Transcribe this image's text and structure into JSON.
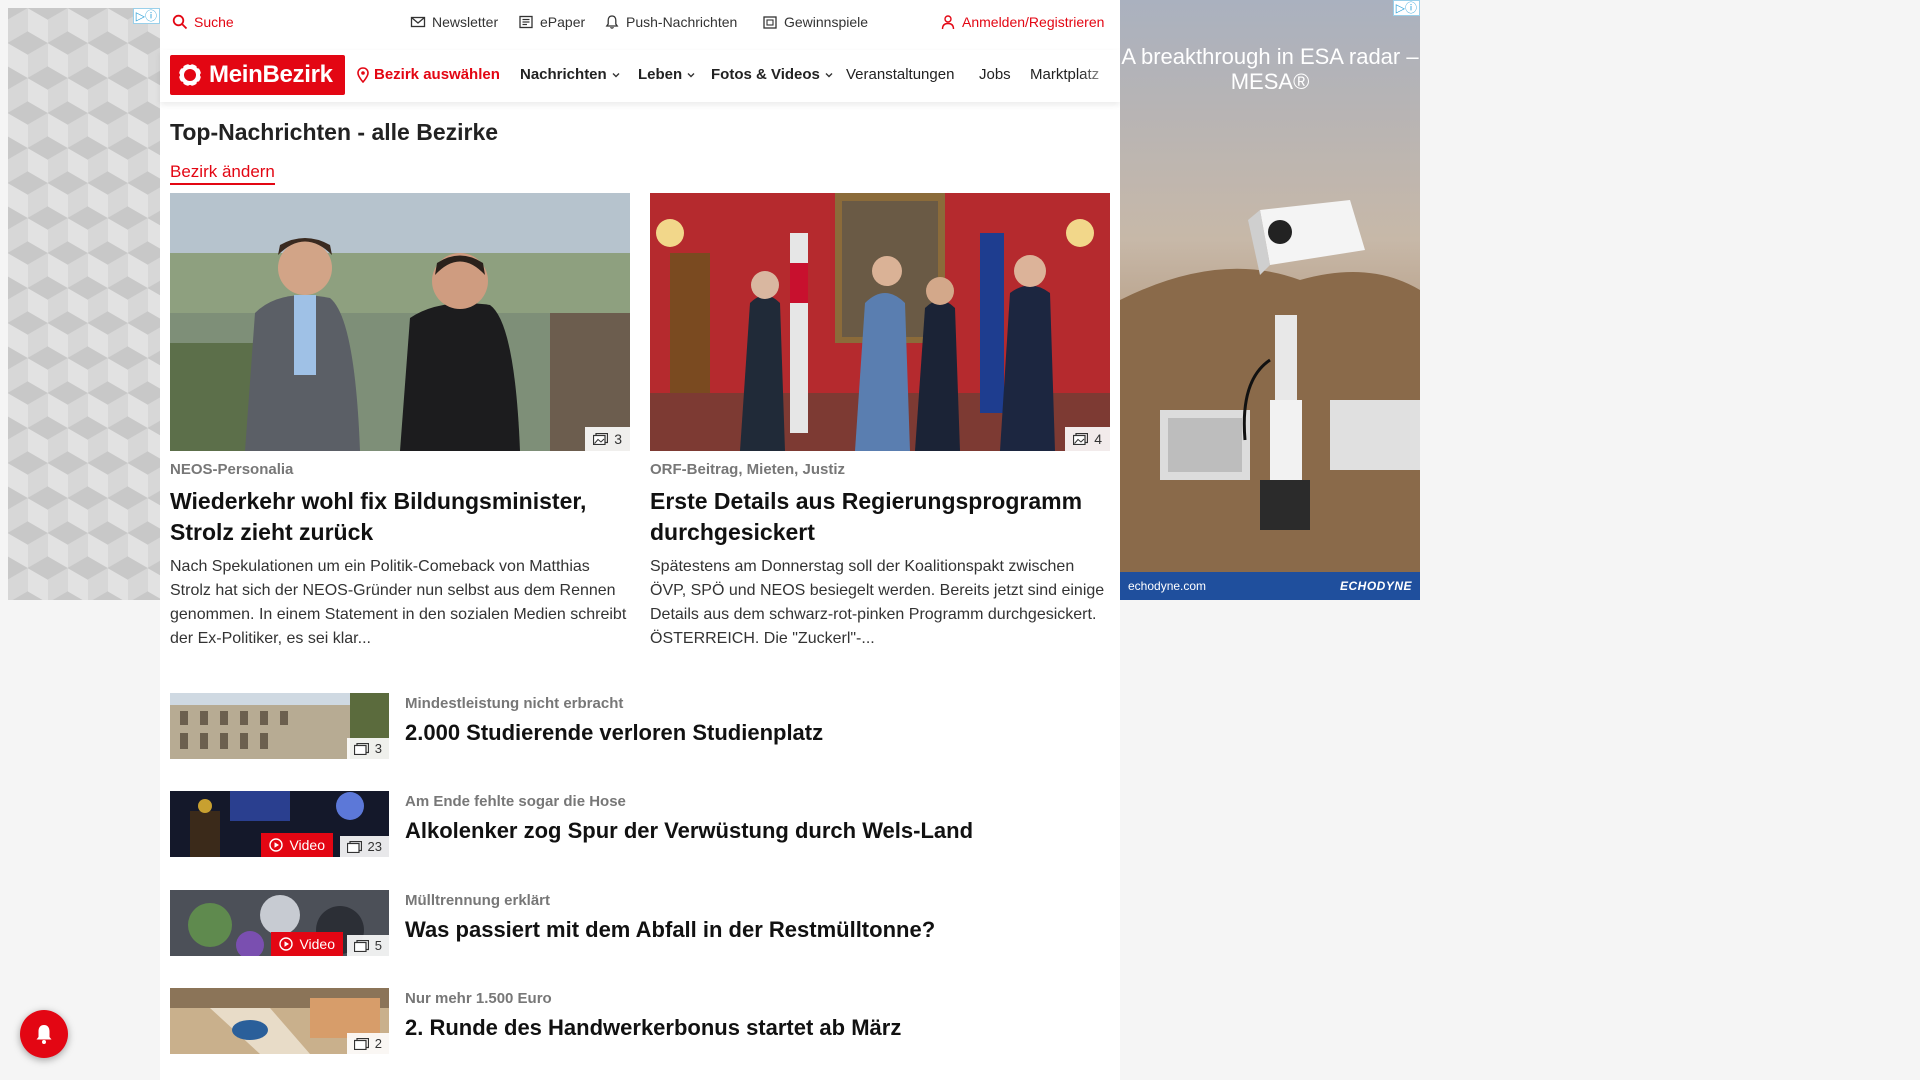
{
  "left_ad": {
    "adchoices_label": "▷ⓘ"
  },
  "topbar": {
    "search_label": "Suche",
    "newsletter_label": "Newsletter",
    "epaper_label": "ePaper",
    "push_label": "Push-Nachrichten",
    "sweepstakes_label": "Gewinnspiele",
    "login_label": "Anmelden/Registrieren"
  },
  "navbar": {
    "logo_text": "MeinBezirk",
    "select_district_label": "Bezirk auswählen",
    "items": [
      {
        "label": "Nachrichten",
        "has_dropdown": true
      },
      {
        "label": "Leben",
        "has_dropdown": true
      },
      {
        "label": "Fotos & Videos",
        "has_dropdown": true
      },
      {
        "label": "Veranstaltungen",
        "has_dropdown": false
      },
      {
        "label": "Jobs",
        "has_dropdown": false
      },
      {
        "label": "Marktplatz",
        "has_dropdown": false
      }
    ]
  },
  "section": {
    "title": "Top-Nachrichten - alle Bezirke",
    "change_district_label": "Bezirk ändern"
  },
  "featured": [
    {
      "image_count": "3",
      "kicker": "NEOS-Personalia",
      "headline": "Wiederkehr wohl fix Bildungsminister, Strolz zieht zurück",
      "teaser": "Nach Spekulationen um ein Politik-Comeback von Matthias Strolz hat sich der NEOS-Gründer nun selbst aus dem Rennen genommen. In einem Statement in den sozialen Medien schreibt der Ex-Politiker, es sei klar..."
    },
    {
      "image_count": "4",
      "kicker": "ORF-Beitrag, Mieten, Justiz",
      "headline": "Erste Details aus Regierungsprogramm durchgesickert",
      "teaser": "Spätestens am Donnerstag soll der Koalitionspakt zwischen ÖVP, SPÖ und NEOS besiegelt werden. Bereits jetzt sind einige Details aus dem schwarz-rot-pinken Programm durchgesickert.  ÖSTERREICH. Die \"Zuckerl\"-..."
    }
  ],
  "articles": [
    {
      "kicker": "Mindestleistung nicht erbracht",
      "headline": "2.000 Studierende verloren Studienplatz",
      "image_count": "3",
      "video_label": ""
    },
    {
      "kicker": "Am Ende fehlte sogar die Hose",
      "headline": "Alkolenker zog Spur der Verwüstung durch Wels-Land",
      "image_count": "23",
      "video_label": "Video"
    },
    {
      "kicker": "Mülltrennung erklärt",
      "headline": "Was passiert mit dem Abfall in der Restmülltonne?",
      "image_count": "5",
      "video_label": "Video"
    },
    {
      "kicker": "Nur mehr 1.500 Euro",
      "headline": "2. Runde des Handwerkerbonus startet ab März",
      "image_count": "2",
      "video_label": ""
    }
  ],
  "right_ad": {
    "adchoices_label": "▷ⓘ",
    "headline": "A breakthrough in ESA radar – MESA®",
    "domain": "echodyne.com",
    "brand": "ECHODYNE"
  },
  "colors": {
    "brand_red": "#e30613",
    "ad_footer_blue": "#1f4f9d"
  }
}
